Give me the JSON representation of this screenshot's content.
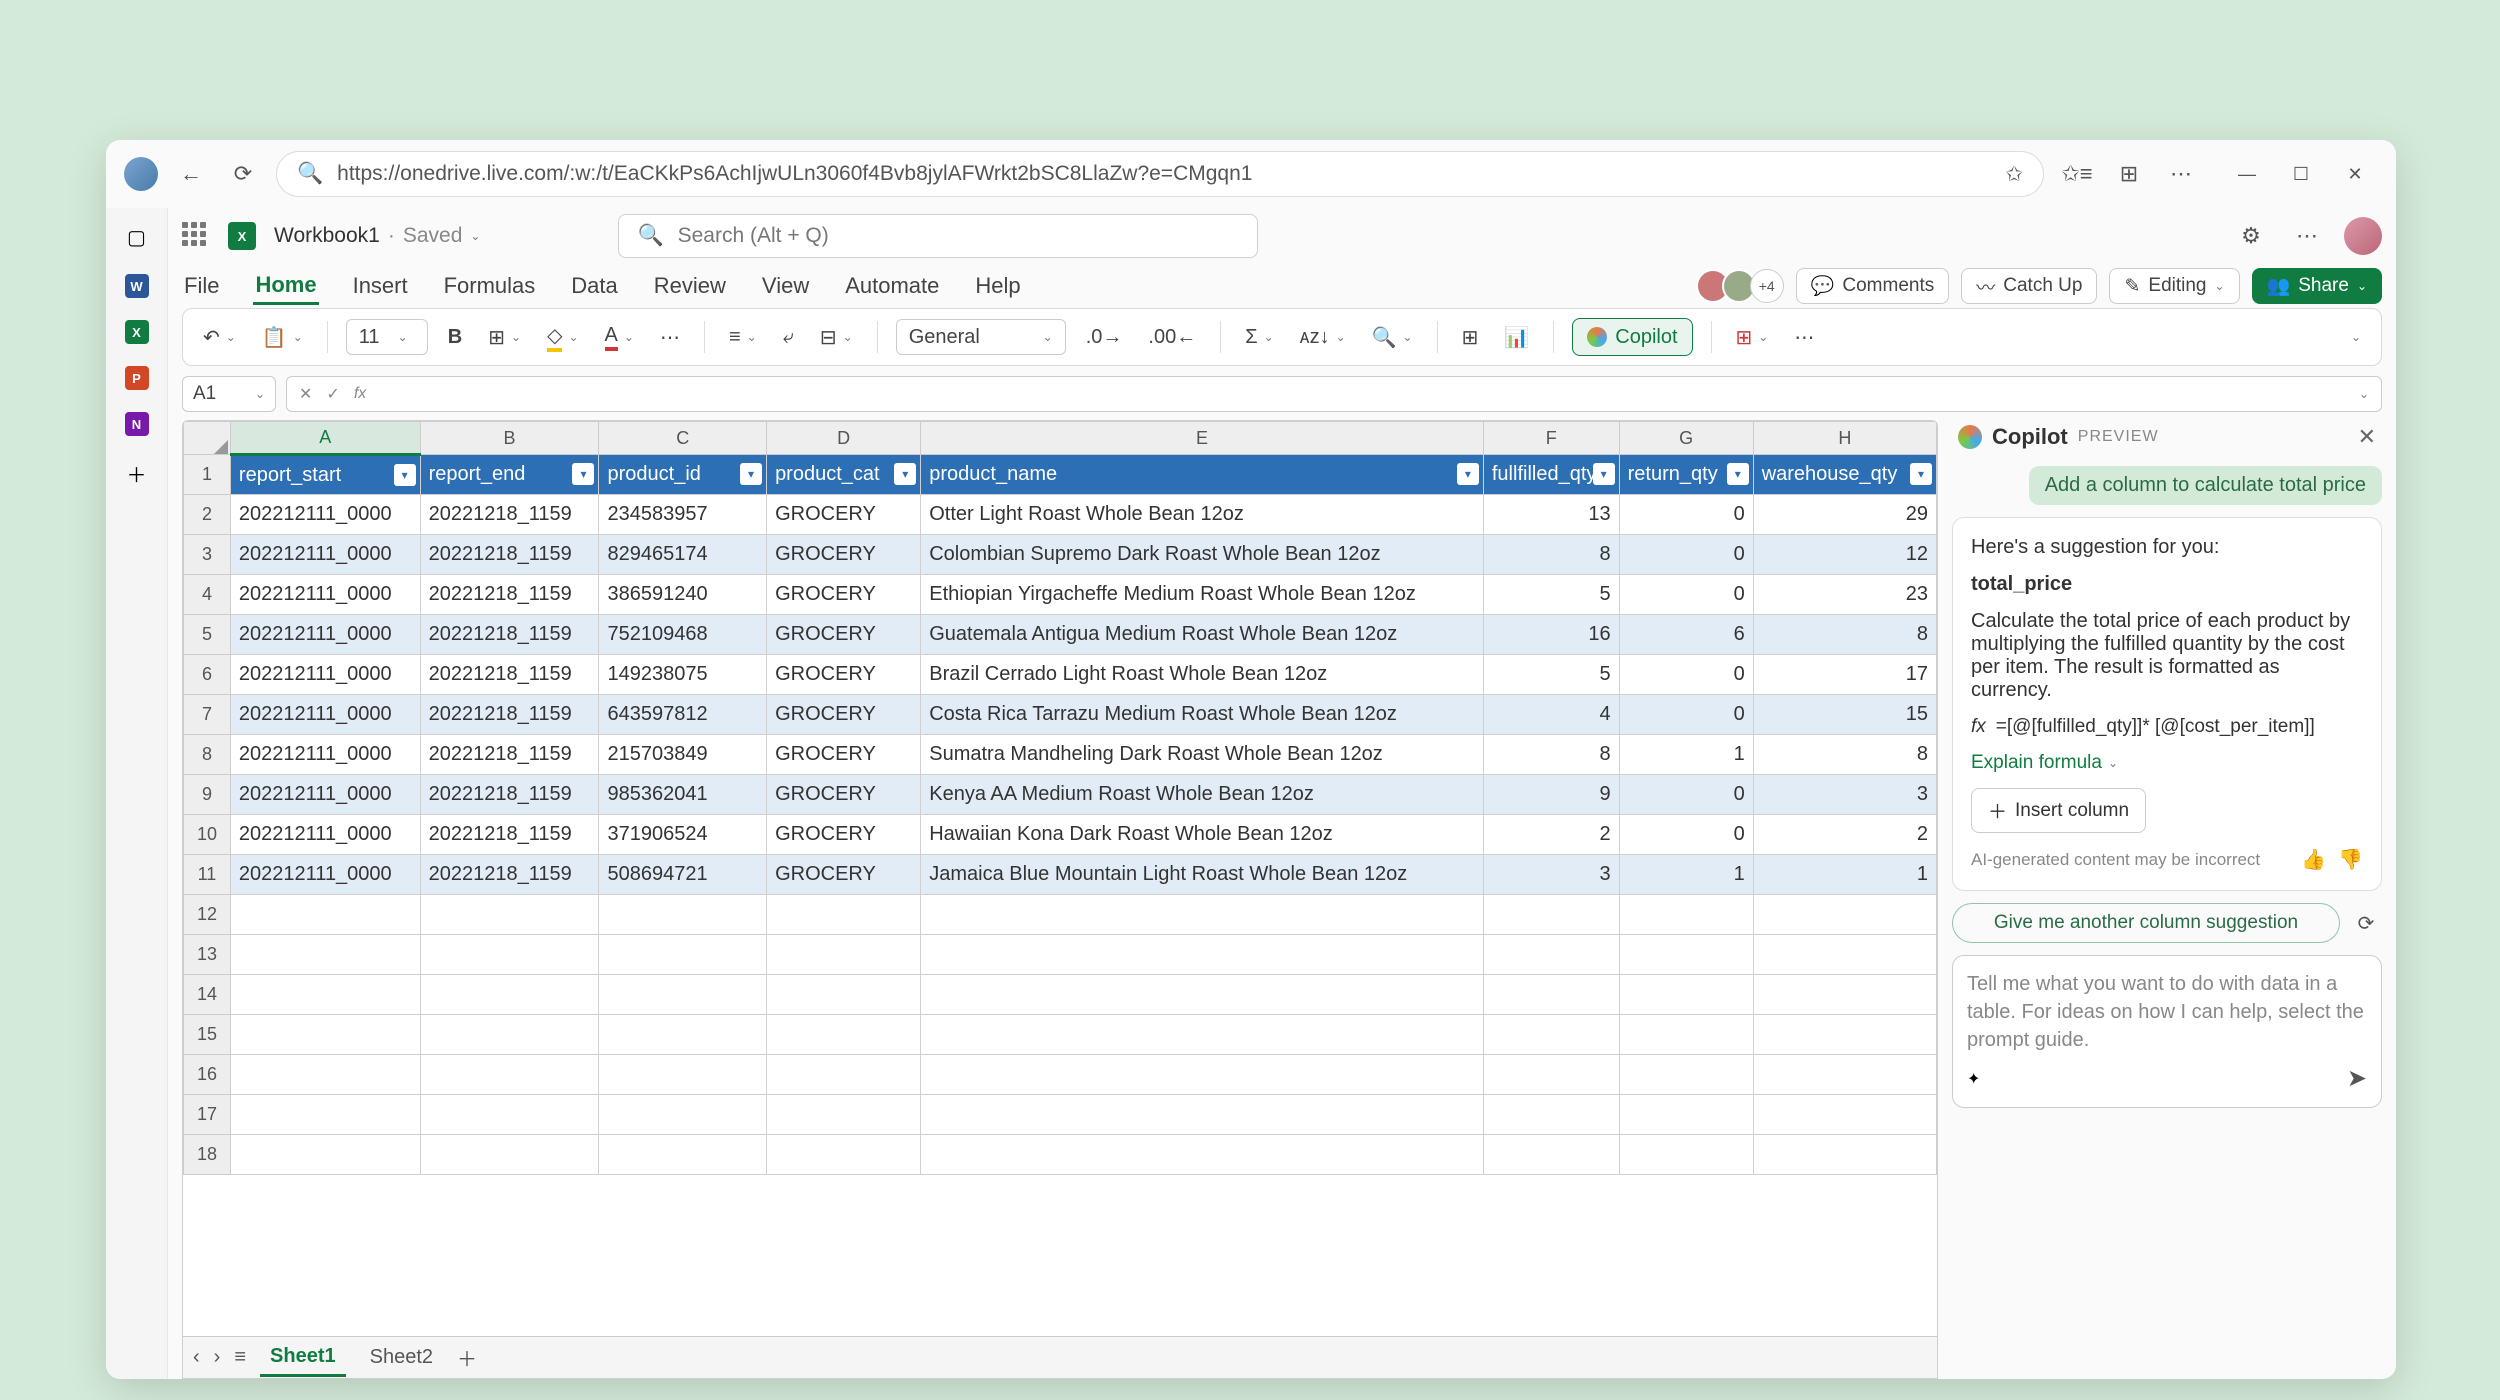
{
  "url": "https://onedrive.live.com/:w:/t/EaCKkPs6AchIjwULn3060f4Bvb8jylAFWrkt2bSC8LlaZw?e=CMgqn1",
  "doc": {
    "name": "Workbook1",
    "status": "Saved"
  },
  "search_placeholder": "Search (Alt + Q)",
  "tabs": [
    "File",
    "Home",
    "Insert",
    "Formulas",
    "Data",
    "Review",
    "View",
    "Automate",
    "Help"
  ],
  "presence_more": "+4",
  "btn": {
    "comments": "Comments",
    "catchup": "Catch Up",
    "editing": "Editing",
    "share": "Share",
    "copilot": "Copilot"
  },
  "toolbar": {
    "fontsize": "11",
    "numfmt": "General"
  },
  "namebox": "A1",
  "columns": [
    "A",
    "B",
    "C",
    "D",
    "E",
    "F",
    "G",
    "H"
  ],
  "headers": [
    "report_start",
    "report_end",
    "product_id",
    "product_cat",
    "product_name",
    "fullfilled_qty",
    "return_qty",
    "warehouse_qty"
  ],
  "rows": [
    [
      "202212111_0000",
      "20221218_1159",
      "234583957",
      "GROCERY",
      "Otter Light Roast Whole Bean 12oz",
      "13",
      "0",
      "29"
    ],
    [
      "202212111_0000",
      "20221218_1159",
      "829465174",
      "GROCERY",
      "Colombian Supremo Dark Roast Whole Bean 12oz",
      "8",
      "0",
      "12"
    ],
    [
      "202212111_0000",
      "20221218_1159",
      "386591240",
      "GROCERY",
      "Ethiopian Yirgacheffe Medium Roast Whole Bean 12oz",
      "5",
      "0",
      "23"
    ],
    [
      "202212111_0000",
      "20221218_1159",
      "752109468",
      "GROCERY",
      "Guatemala Antigua Medium Roast Whole Bean 12oz",
      "16",
      "6",
      "8"
    ],
    [
      "202212111_0000",
      "20221218_1159",
      "149238075",
      "GROCERY",
      "Brazil Cerrado Light Roast Whole Bean 12oz",
      "5",
      "0",
      "17"
    ],
    [
      "202212111_0000",
      "20221218_1159",
      "643597812",
      "GROCERY",
      "Costa Rica Tarrazu Medium Roast Whole Bean 12oz",
      "4",
      "0",
      "15"
    ],
    [
      "202212111_0000",
      "20221218_1159",
      "215703849",
      "GROCERY",
      "Sumatra Mandheling Dark Roast Whole Bean 12oz",
      "8",
      "1",
      "8"
    ],
    [
      "202212111_0000",
      "20221218_1159",
      "985362041",
      "GROCERY",
      "Kenya AA Medium Roast Whole Bean 12oz",
      "9",
      "0",
      "3"
    ],
    [
      "202212111_0000",
      "20221218_1159",
      "371906524",
      "GROCERY",
      "Hawaiian Kona Dark Roast Whole Bean 12oz",
      "2",
      "0",
      "2"
    ],
    [
      "202212111_0000",
      "20221218_1159",
      "508694721",
      "GROCERY",
      "Jamaica Blue Mountain Light Roast Whole Bean 12oz",
      "3",
      "1",
      "1"
    ]
  ],
  "empty_rows": [
    "12",
    "13",
    "14",
    "15",
    "16",
    "17",
    "18"
  ],
  "sheets": [
    "Sheet1",
    "Sheet2"
  ],
  "copilot": {
    "title": "Copilot",
    "badge": "PREVIEW",
    "chip": "Add a column to calculate total price",
    "intro": "Here's a suggestion for you:",
    "col_name": "total_price",
    "desc": "Calculate the total price of each product by multiplying the fulfilled quantity by the cost per item. The result is formatted as currency.",
    "formula": "=[@[fulfilled_qty]]* [@[cost_per_item]]",
    "explain": "Explain formula",
    "insert": "Insert column",
    "disclaimer": "AI-generated content may be incorrect",
    "suggest": "Give me another column suggestion",
    "prompt_placeholder": "Tell me what you want to do with data in a table. For ideas on how I can help, select the prompt guide."
  }
}
